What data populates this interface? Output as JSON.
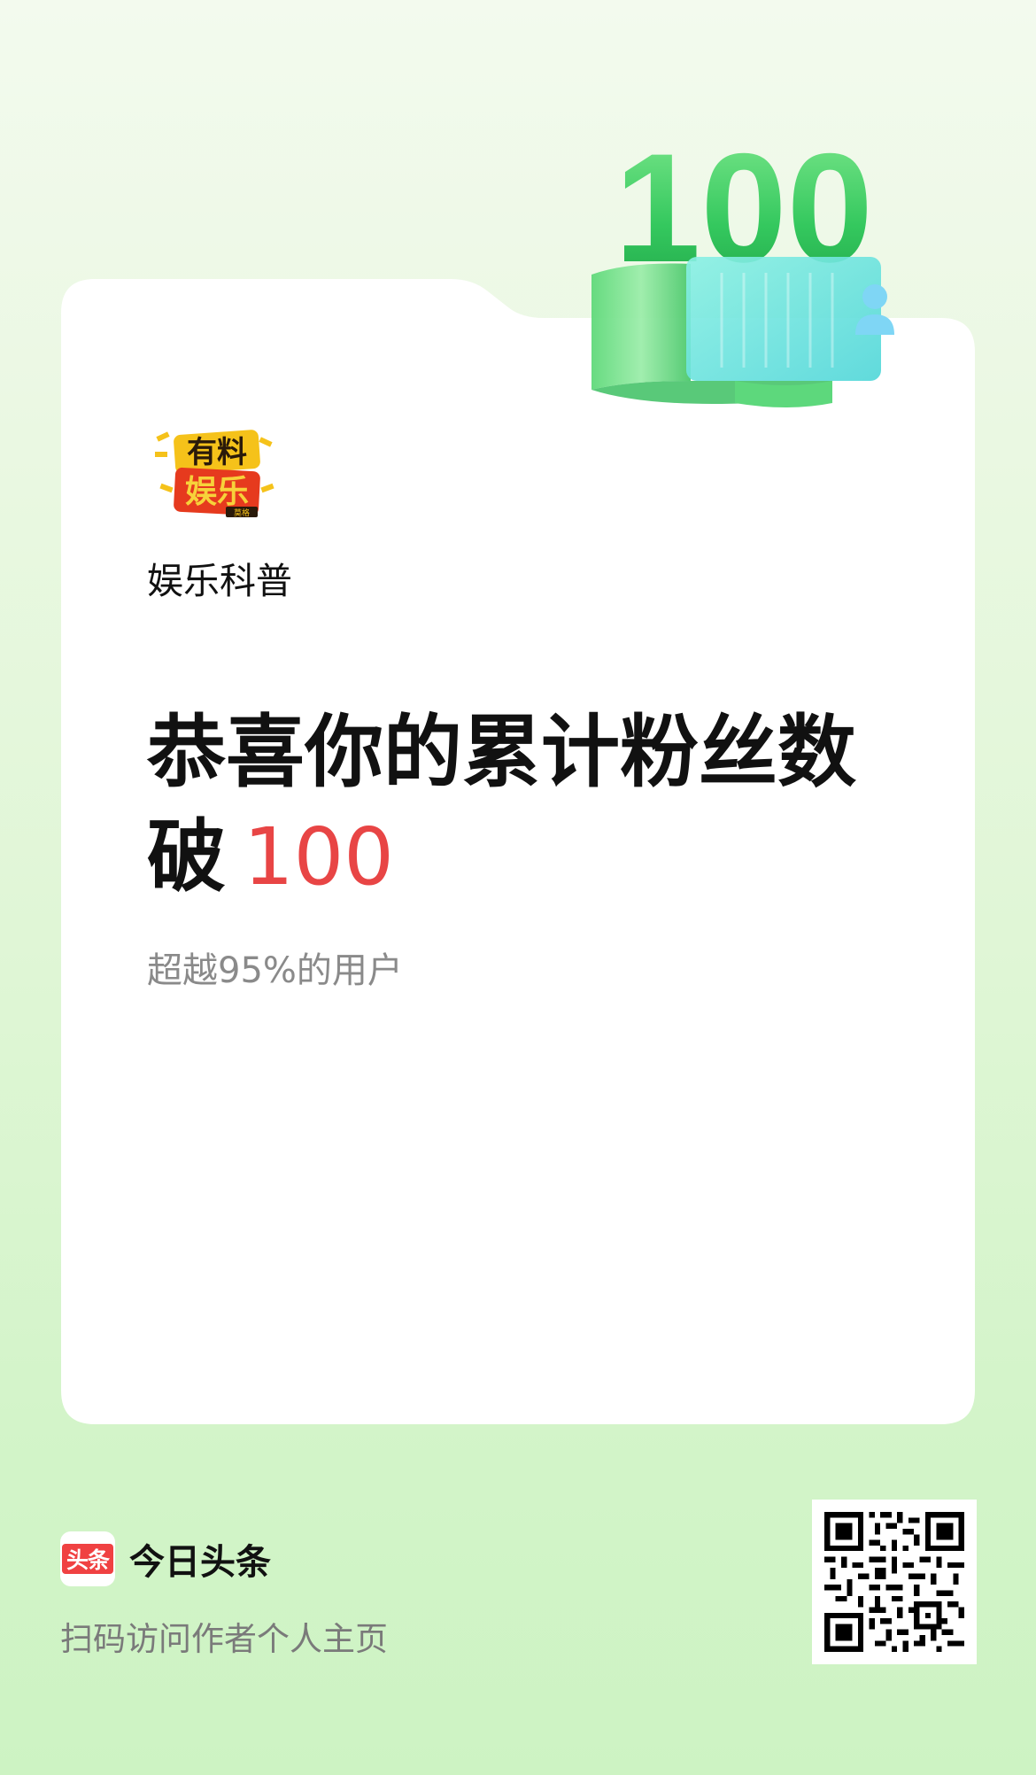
{
  "author": {
    "name": "娱乐科普",
    "avatar_text_top": "有料",
    "avatar_text_bottom": "娱乐",
    "avatar_tag": "莫格"
  },
  "badge": {
    "number": "100"
  },
  "headline": {
    "line1": "恭喜你的累计粉丝数",
    "line2_prefix": "破",
    "count": "100"
  },
  "subline": "超越95%的用户",
  "footer": {
    "logo_text": "头条",
    "brand_name": "今日头条",
    "scan_text": "扫码访问作者个人主页"
  },
  "colors": {
    "accent_red": "#e84545",
    "brand_red": "#f04142",
    "badge_green": "#3dd16a"
  }
}
